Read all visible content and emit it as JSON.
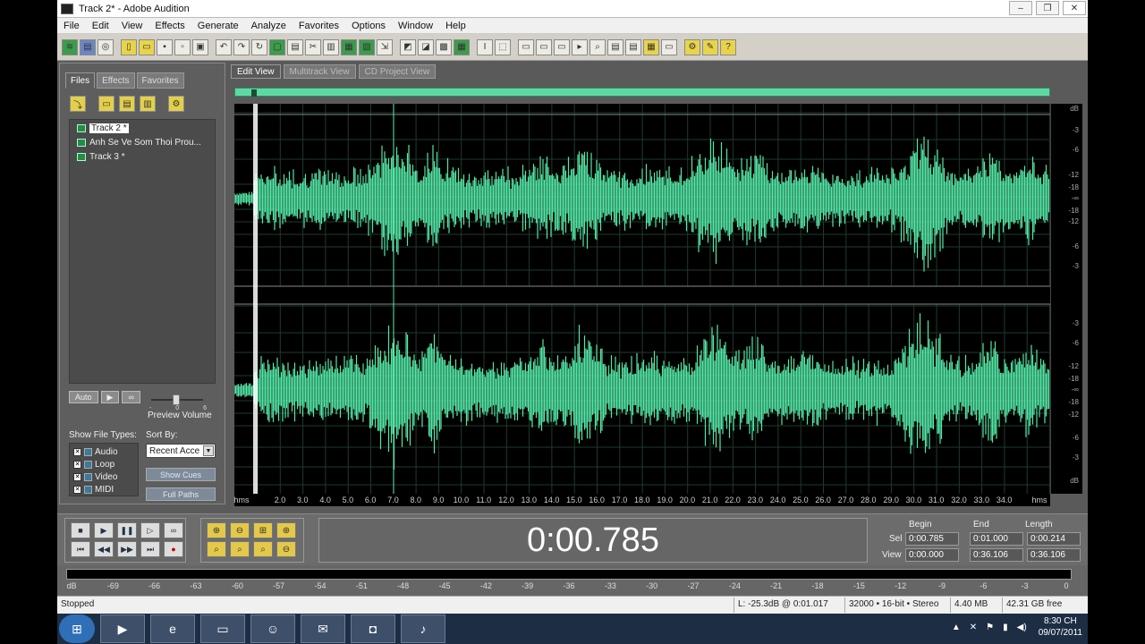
{
  "window": {
    "title": "Track 2* - Adobe Audition",
    "controls": [
      "–",
      "❐",
      "✕"
    ]
  },
  "menu": [
    "File",
    "Edit",
    "View",
    "Effects",
    "Generate",
    "Analyze",
    "Favorites",
    "Options",
    "Window",
    "Help"
  ],
  "left_panel": {
    "tabs": [
      "Files",
      "Effects",
      "Favorites"
    ],
    "files": [
      "Track 2 *",
      "Anh Se Ve Som Thoi Prou...",
      "Track 3 *"
    ],
    "auto_label": "Auto",
    "preview_volume_label": "Preview Volume",
    "preview_volume_ticks": [
      "-",
      "0",
      "6"
    ],
    "show_file_types_label": "Show File Types:",
    "file_types": [
      "Audio",
      "Loop",
      "Video",
      "MIDI"
    ],
    "sort_by_label": "Sort By:",
    "sort_by_value": "Recent Acce",
    "show_cues_label": "Show Cues",
    "full_paths_label": "Full Paths"
  },
  "view_tabs": [
    "Edit View",
    "Multitrack View",
    "CD Project View"
  ],
  "db_scale": {
    "top_label": "dB",
    "bottom_label": "dB",
    "channel1": [
      "-3",
      "-6",
      "-12",
      "-18",
      "-∞",
      "-18",
      "-12",
      "-6",
      "-3"
    ],
    "channel2": [
      "-3",
      "-6",
      "-12",
      "-18",
      "-∞",
      "-18",
      "-12",
      "-6",
      "-3"
    ]
  },
  "timeline": {
    "start_label": "hms",
    "end_label": "hms",
    "ticks": [
      "2.0",
      "3.0",
      "4.0",
      "5.0",
      "6.0",
      "7.0",
      "8.0",
      "9.0",
      "10.0",
      "11.0",
      "12.0",
      "13.0",
      "14.0",
      "15.0",
      "16.0",
      "17.0",
      "18.0",
      "19.0",
      "20.0",
      "21.0",
      "22.0",
      "23.0",
      "24.0",
      "25.0",
      "26.0",
      "27.0",
      "28.0",
      "29.0",
      "30.0",
      "31.0",
      "32.0",
      "33.0",
      "34.0"
    ]
  },
  "transport": {
    "time_display": "0:00.785",
    "columns": [
      "Begin",
      "End",
      "Length"
    ],
    "rows": [
      {
        "label": "Sel",
        "begin": "0:00.785",
        "end": "0:01.000",
        "length": "0:00.214"
      },
      {
        "label": "View",
        "begin": "0:00.000",
        "end": "0:36.106",
        "length": "0:36.106"
      }
    ]
  },
  "meter_scale": [
    "dB",
    "-69",
    "-66",
    "-63",
    "-60",
    "-57",
    "-54",
    "-51",
    "-48",
    "-45",
    "-42",
    "-39",
    "-36",
    "-33",
    "-30",
    "-27",
    "-24",
    "-21",
    "-18",
    "-15",
    "-12",
    "-9",
    "-6",
    "-3",
    "0"
  ],
  "status": {
    "state": "Stopped",
    "level": "L: -25.3dB @   0:01.017",
    "format": "32000 • 16-bit • Stereo",
    "size": "4.40 MB",
    "free": "42.31 GB free"
  },
  "taskbar": {
    "time": "8:30 CH",
    "date": "09/07/2011"
  },
  "colors": {
    "waveform": "#54e6a6",
    "overview": "#5fd9a3",
    "background": "#000000"
  }
}
